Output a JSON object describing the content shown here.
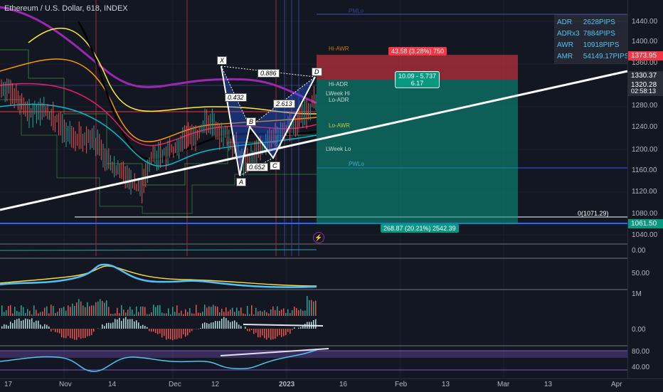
{
  "header": {
    "symbol_title": "Ethereum / U.S. Dollar, 618, INDEX"
  },
  "stats_box": {
    "rows": [
      {
        "key": "ADR",
        "value": "2628PIPS"
      },
      {
        "key": "ADRx3",
        "value": "7884PIPS"
      },
      {
        "key": "AWR",
        "value": "10918PIPS"
      },
      {
        "key": "AMR",
        "value": "54149.17PIPS"
      }
    ]
  },
  "price_axis": {
    "ticks": [
      "1440.00",
      "1400.00",
      "1360.00",
      "1280.00",
      "1240.00",
      "1200.00",
      "1160.00",
      "1120.00",
      "1080.00",
      "1040.00"
    ],
    "tags": [
      {
        "value": "1373.95",
        "color": "#f23645"
      },
      {
        "value": "1330.37",
        "color": "#2a2e39"
      },
      {
        "value": "1320.28",
        "color": "#2a2e39"
      },
      {
        "value": "02:58:13",
        "color": "#2a2e39"
      },
      {
        "value": "1061.50",
        "color": "#089981"
      }
    ]
  },
  "pane_axes": {
    "volume_zero": "0.00",
    "rsi_top": "50.00",
    "volume_1m": "1M",
    "macd_zero": "0.00",
    "stoch_80": "80.00",
    "stoch_40": "40.00"
  },
  "time_axis": {
    "ticks": [
      "17",
      "Nov",
      "14",
      "Dec",
      "12",
      "2023",
      "16",
      "Feb",
      "13",
      "Mar",
      "13",
      "Apr"
    ]
  },
  "position_tool": {
    "stop_label": "43.58 (3.28%) 750",
    "ratio_line1": "10.09 - 5.737",
    "ratio_line2": "6.17",
    "target_label": "268.87 (20.21%) 2542.39",
    "zero_label": "0(1071.29)"
  },
  "pattern": {
    "points": [
      "X",
      "A",
      "B",
      "C",
      "D"
    ],
    "ratios": [
      "0.886",
      "0.432",
      "2.613",
      "0.652"
    ]
  },
  "level_labels": [
    "Hi-AWR",
    "Hi-ADR",
    "LWeek Hi",
    "Lo-ADR",
    "Lo-AWR",
    "LWeek Lo",
    "PWLo",
    "PMLo"
  ],
  "colors": {
    "bg": "#131722",
    "green": "#089981",
    "red": "#f23645",
    "accent_cyan": "#4fc3f7"
  }
}
